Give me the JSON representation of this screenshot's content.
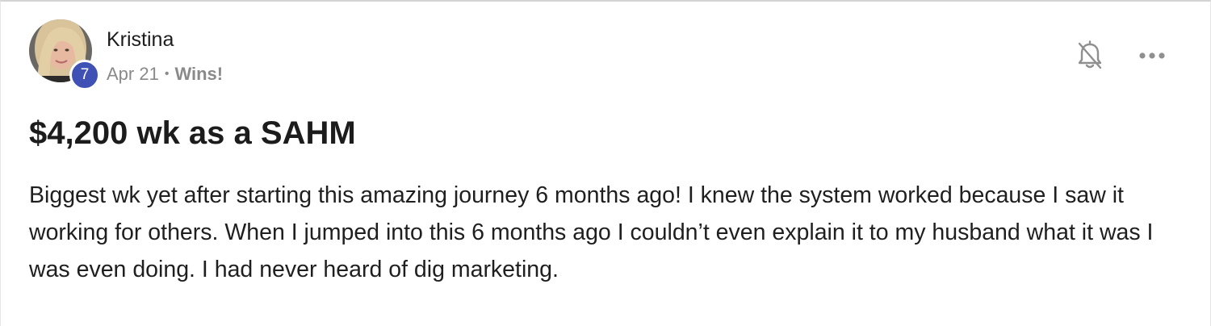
{
  "post": {
    "author": "Kristina",
    "level": "7",
    "date": "Apr 21",
    "separator": "•",
    "category": "Wins!",
    "title": "$4,200 wk as a SAHM",
    "body": "Biggest wk yet after starting this amazing journey 6 months ago! I knew the system worked because I saw it working for others. When I jumped into this 6 months ago I couldn’t even explain it to my husband what it was I was even doing. I had never heard of dig marketing."
  },
  "icons": {
    "avatar": "profile-photo",
    "notifications": "bell-off-icon",
    "more": "more-horizontal-icon"
  },
  "colors": {
    "level_badge": "#3f51b5",
    "meta_text": "#8a8a8a",
    "text": "#1c1c1c",
    "icon": "#8f8f8f"
  }
}
